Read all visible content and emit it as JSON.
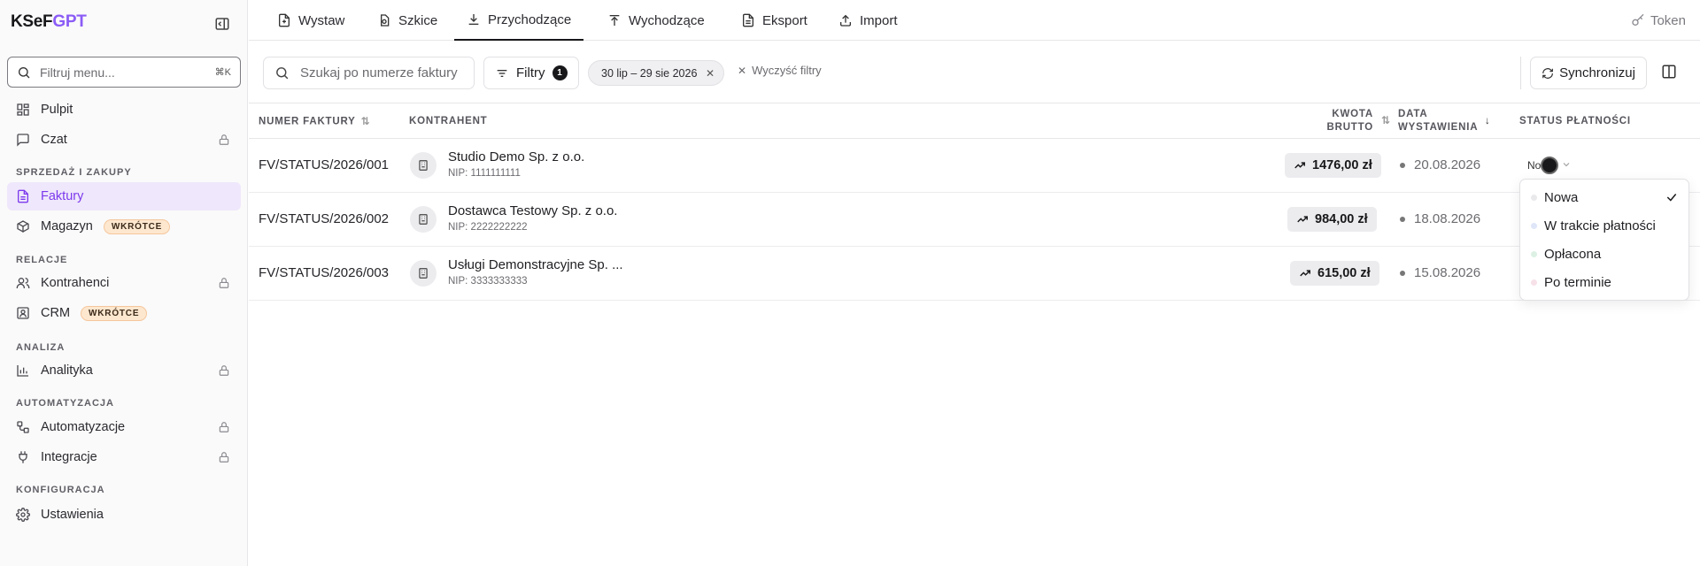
{
  "brand": {
    "prefix": "KSeF",
    "suffix": "GPT"
  },
  "sidebar": {
    "filter_placeholder": "Filtruj menu...",
    "filter_shortcut": "⌘K",
    "items": [
      {
        "label": "Pulpit",
        "icon": "dashboard-icon"
      },
      {
        "label": "Czat",
        "icon": "chat-icon",
        "locked": true
      },
      {
        "label": "Faktury",
        "icon": "document-icon",
        "active": true
      },
      {
        "label": "Magazyn",
        "icon": "box-icon",
        "badge": "WKRÓTCE"
      },
      {
        "label": "Kontrahenci",
        "icon": "users-icon",
        "locked": true
      },
      {
        "label": "CRM",
        "icon": "contact-icon",
        "badge": "WKRÓTCE"
      },
      {
        "label": "Analityka",
        "icon": "chart-icon",
        "locked": true
      },
      {
        "label": "Automatyzacje",
        "icon": "workflow-icon",
        "locked": true
      },
      {
        "label": "Integracje",
        "icon": "plug-icon",
        "locked": true
      },
      {
        "label": "Ustawienia",
        "icon": "gear-icon"
      }
    ],
    "sections": [
      "SPRZEDAŻ I ZAKUPY",
      "RELACJE",
      "ANALIZA",
      "AUTOMATYZACJA",
      "KONFIGURACJA"
    ]
  },
  "tabs": [
    {
      "label": "Wystaw",
      "icon": "file-plus-icon"
    },
    {
      "label": "Szkice",
      "icon": "drafts-icon"
    },
    {
      "label": "Przychodzące",
      "icon": "download-icon",
      "active": true
    },
    {
      "label": "Wychodzące",
      "icon": "upload-icon"
    },
    {
      "label": "Eksport",
      "icon": "file-text-icon"
    },
    {
      "label": "Import",
      "icon": "import-icon"
    }
  ],
  "token_label": "Token",
  "toolbar": {
    "search_placeholder": "Szukaj po numerze faktury",
    "filters_label": "Filtry",
    "filters_count": "1",
    "date_chip": "30 lip – 29 sie 2026",
    "clear_label": "Wyczyść filtry",
    "sync_label": "Synchronizuj"
  },
  "table": {
    "headers": {
      "number": "NUMER FAKTURY",
      "contractor": "KONTRAHENT",
      "amount_line1": "KWOTA",
      "amount_line2": "BRUTTO",
      "date_line1": "DATA",
      "date_line2": "WYSTAWIENIA",
      "status": "STATUS PŁATNOŚCI"
    },
    "rows": [
      {
        "number": "FV/STATUS/2026/001",
        "name": "Studio Demo Sp. z o.o.",
        "nip": "NIP: 1111111111",
        "amount": "1476,00 zł",
        "date": "20.08.2026"
      },
      {
        "number": "FV/STATUS/2026/002",
        "name": "Dostawca Testowy Sp. z o.o.",
        "nip": "NIP: 2222222222",
        "amount": "984,00 zł",
        "date": "18.08.2026"
      },
      {
        "number": "FV/STATUS/2026/003",
        "name": "Usługi Demonstracyjne Sp. ...",
        "nip": "NIP: 3333333333",
        "amount": "615,00 zł",
        "date": "15.08.2026"
      }
    ]
  },
  "status_trigger": "No",
  "status_options": [
    {
      "label": "Nowa",
      "color": "#e9e9ec",
      "selected": true
    },
    {
      "label": "W trakcie płatności",
      "color": "#dfe6f8"
    },
    {
      "label": "Opłacona",
      "color": "#dcf1e4"
    },
    {
      "label": "Po terminie",
      "color": "#f7e1e8"
    }
  ],
  "colors": {
    "accent": "#8b5cf6",
    "active_bg": "#efe7fb"
  }
}
